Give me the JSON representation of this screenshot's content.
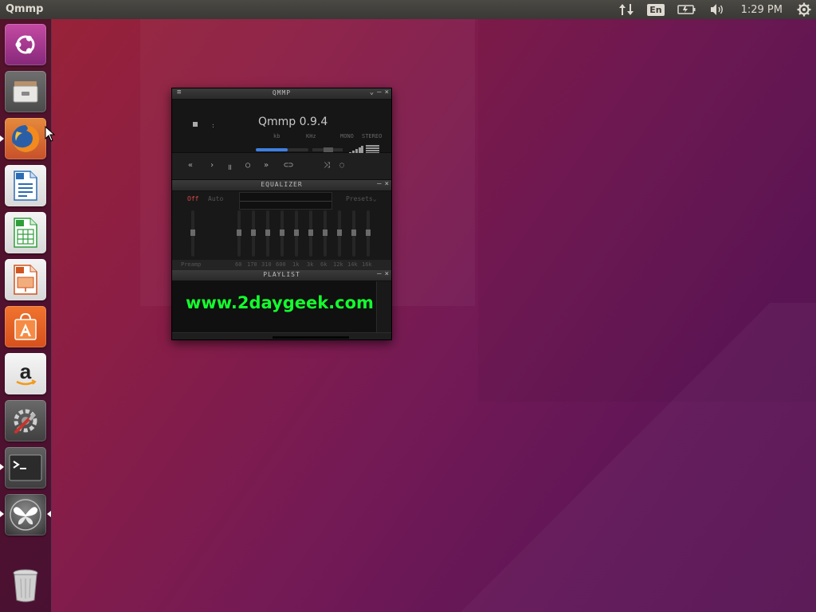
{
  "top_panel": {
    "app_title": "Qmmp",
    "keyboard_layout": "En",
    "clock": "1:29 PM"
  },
  "launcher": {
    "items": [
      {
        "name": "ubuntu-dash"
      },
      {
        "name": "files"
      },
      {
        "name": "firefox",
        "running": true
      },
      {
        "name": "libreoffice-writer"
      },
      {
        "name": "libreoffice-calc"
      },
      {
        "name": "libreoffice-impress"
      },
      {
        "name": "ubuntu-software"
      },
      {
        "name": "amazon"
      },
      {
        "name": "system-settings"
      },
      {
        "name": "terminal",
        "running": true
      },
      {
        "name": "qmmp",
        "running": true,
        "focused": true
      },
      {
        "name": "trash"
      }
    ]
  },
  "player": {
    "window_title": "QMMP",
    "track_title": "Qmmp 0.9.4",
    "time": ":",
    "label_kb": "kb",
    "label_khz": "KHz",
    "label_mono": "MONO",
    "label_stereo": "STEREO",
    "volume_percent": 60
  },
  "equalizer": {
    "window_title": "EQUALIZER",
    "off_label": "Off",
    "auto_label": "Auto",
    "presets_label": "Presets",
    "preamp_label": "Preamp",
    "frequencies": [
      "60",
      "170",
      "310",
      "600",
      "1k",
      "3k",
      "6k",
      "12k",
      "14k",
      "16k"
    ]
  },
  "playlist": {
    "window_title": "PLAYLIST",
    "watermark": "www.2daygeek.com"
  },
  "colors": {
    "accent_blue": "#3f7fe0",
    "eq_off_red": "#e04848",
    "watermark_green": "#14ff2e"
  }
}
